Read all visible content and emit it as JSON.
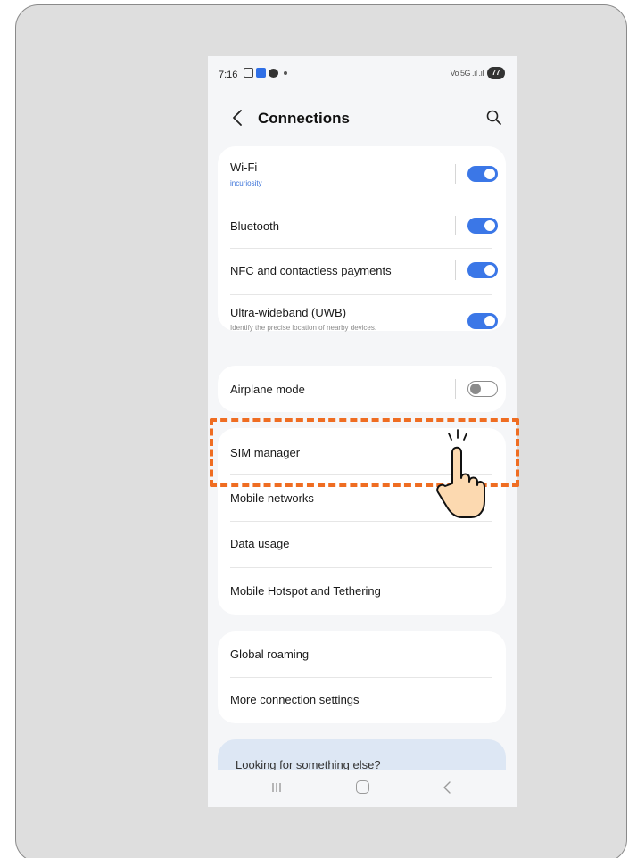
{
  "status_bar": {
    "time": "7:16",
    "signal_text": "Vo 5G .ıl .ıl",
    "battery": "77"
  },
  "header": {
    "title": "Connections",
    "back_icon": "chevron-left-icon",
    "search_icon": "search-icon"
  },
  "groups": [
    {
      "items": [
        {
          "label": "Wi-Fi",
          "sub": "incuriosity",
          "toggle": true,
          "enabled": true
        },
        {
          "label": "Bluetooth",
          "toggle": true,
          "enabled": true
        },
        {
          "label": "NFC and contactless payments",
          "toggle": true,
          "enabled": true
        },
        {
          "label": "Ultra-wideband (UWB)",
          "sub": "Identify the precise location of nearby devices.",
          "toggle": true,
          "enabled": true
        }
      ]
    },
    {
      "items": [
        {
          "label": "Airplane mode",
          "toggle": true,
          "enabled": false
        }
      ]
    },
    {
      "items": [
        {
          "label": "SIM manager"
        },
        {
          "label": "Mobile networks"
        },
        {
          "label": "Data usage"
        },
        {
          "label": "Mobile Hotspot and Tethering"
        }
      ]
    },
    {
      "items": [
        {
          "label": "Global roaming"
        },
        {
          "label": "More connection settings"
        }
      ]
    }
  ],
  "help": {
    "text": "Looking for something else?"
  },
  "annotation": {
    "highlight_color": "#ef6d22",
    "pointer_icon": "tap-hand-icon"
  },
  "colors": {
    "toggle_on": "#3b77e7",
    "sub_link": "#3a72d8"
  }
}
